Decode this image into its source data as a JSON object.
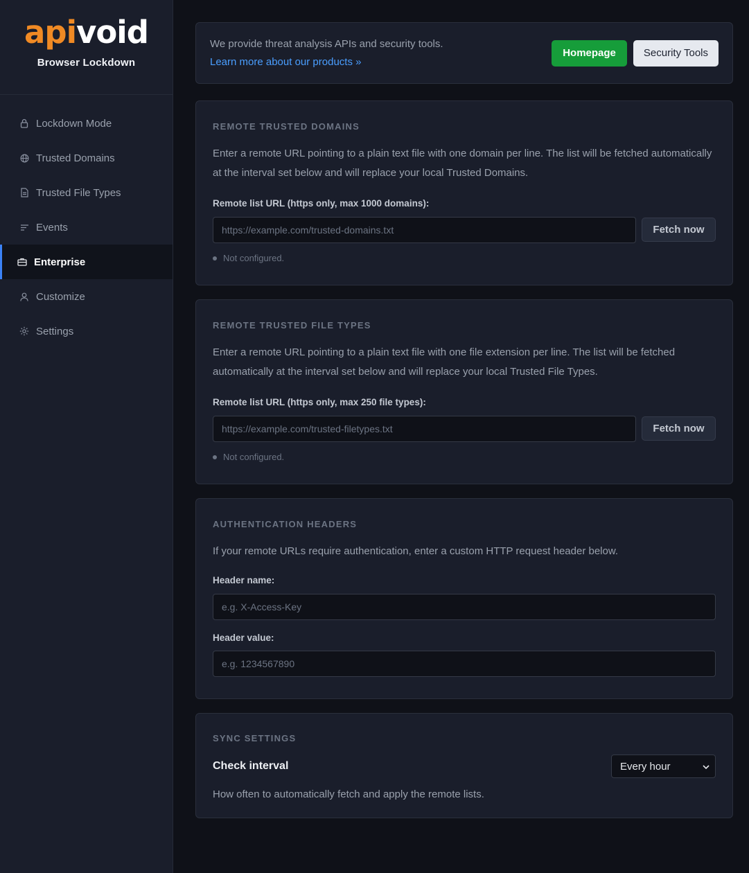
{
  "brand": {
    "logo_part1": "api",
    "logo_part2": "void",
    "subtitle": "Browser Lockdown",
    "logo_colors": {
      "accent": "#f08a24",
      "main": "#ffffff"
    }
  },
  "sidebar": {
    "items": [
      {
        "label": "Lockdown Mode",
        "icon": "lock-icon"
      },
      {
        "label": "Trusted Domains",
        "icon": "globe-icon"
      },
      {
        "label": "Trusted File Types",
        "icon": "file-icon"
      },
      {
        "label": "Events",
        "icon": "list-icon"
      },
      {
        "label": "Enterprise",
        "icon": "briefcase-icon",
        "active": true
      },
      {
        "label": "Customize",
        "icon": "user-icon"
      },
      {
        "label": "Settings",
        "icon": "gear-icon"
      }
    ]
  },
  "banner": {
    "text": "We provide threat analysis APIs and security tools.",
    "link": "Learn more about our products »",
    "homepage_button": "Homepage",
    "security_tools_button": "Security Tools"
  },
  "remote_domains": {
    "title": "REMOTE TRUSTED DOMAINS",
    "description": "Enter a remote URL pointing to a plain text file with one domain per line. The list will be fetched automatically at the interval set below and will replace your local Trusted Domains.",
    "field_label": "Remote list URL (https only, max 1000 domains):",
    "placeholder": "https://example.com/trusted-domains.txt",
    "fetch_button": "Fetch now",
    "status": "Not configured."
  },
  "remote_filetypes": {
    "title": "REMOTE TRUSTED FILE TYPES",
    "description": "Enter a remote URL pointing to a plain text file with one file extension per line. The list will be fetched automatically at the interval set below and will replace your local Trusted File Types.",
    "field_label": "Remote list URL (https only, max 250 file types):",
    "placeholder": "https://example.com/trusted-filetypes.txt",
    "fetch_button": "Fetch now",
    "status": "Not configured."
  },
  "auth_headers": {
    "title": "AUTHENTICATION HEADERS",
    "description": "If your remote URLs require authentication, enter a custom HTTP request header below.",
    "name_label": "Header name:",
    "name_placeholder": "e.g. X-Access-Key",
    "value_label": "Header value:",
    "value_placeholder": "e.g. 1234567890"
  },
  "sync": {
    "title": "SYNC SETTINGS",
    "interval_label": "Check interval",
    "interval_value": "Every hour",
    "description": "How often to automatically fetch and apply the remote lists."
  }
}
